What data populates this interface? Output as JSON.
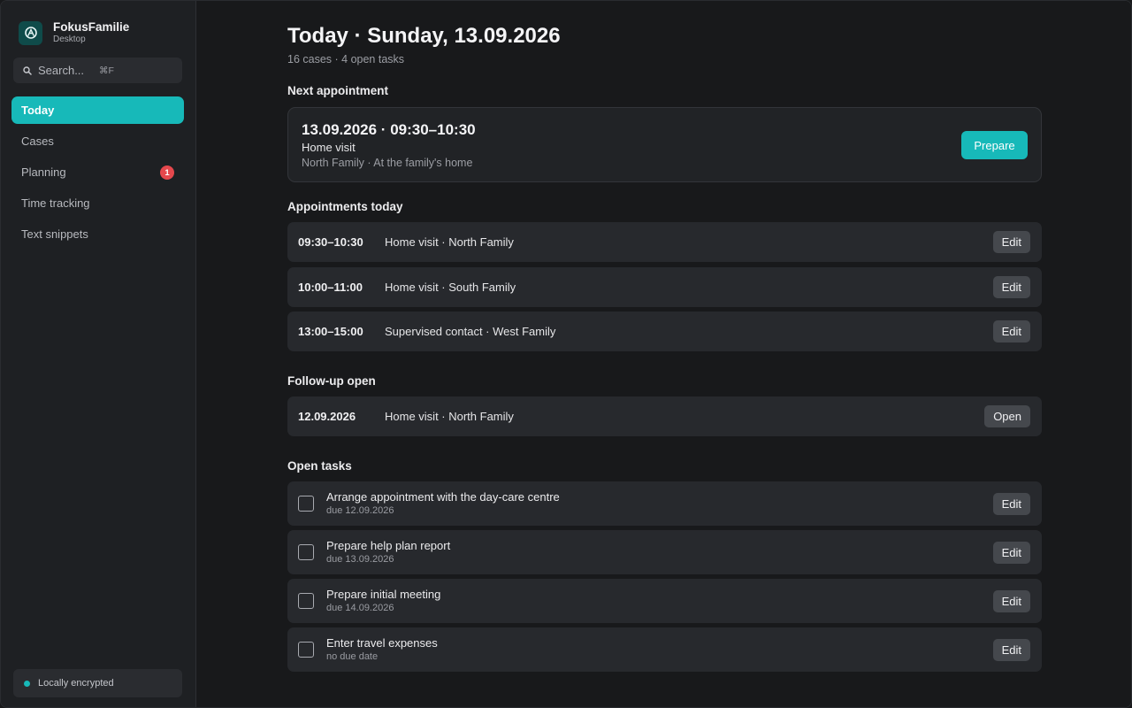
{
  "app": {
    "name": "FokusFamilie",
    "subtitle": "Desktop"
  },
  "search": {
    "placeholder": "Search...",
    "shortcut": "⌘F"
  },
  "nav": [
    {
      "label": "Today",
      "active": true
    },
    {
      "label": "Cases"
    },
    {
      "label": "Planning",
      "badge": "1"
    },
    {
      "label": "Time tracking"
    },
    {
      "label": "Text snippets"
    }
  ],
  "status": {
    "label": "Locally encrypted",
    "color": "#17b9b9"
  },
  "header": {
    "title": "Today · Sunday, 13.09.2026",
    "summary": "16 cases · 4 open tasks"
  },
  "next_appointment": {
    "heading": "Next appointment",
    "when": "13.09.2026 · 09:30–10:30",
    "type": "Home visit",
    "where": "North Family · At the family's home",
    "action": "Prepare"
  },
  "appointments": {
    "heading": "Appointments today",
    "items": [
      {
        "time": "09:30–10:30",
        "desc": "Home visit · North Family",
        "action": "Edit"
      },
      {
        "time": "10:00–11:00",
        "desc": "Home visit · South Family",
        "action": "Edit"
      },
      {
        "time": "13:00–15:00",
        "desc": "Supervised contact · West Family",
        "action": "Edit"
      }
    ]
  },
  "followup": {
    "heading": "Follow-up open",
    "items": [
      {
        "date": "12.09.2026",
        "desc": "Home visit · North Family",
        "action": "Open"
      }
    ]
  },
  "tasks": {
    "heading": "Open tasks",
    "items": [
      {
        "title": "Arrange appointment with the day-care centre",
        "due": "due 12.09.2026",
        "action": "Edit"
      },
      {
        "title": "Prepare help plan report",
        "due": "due 13.09.2026",
        "action": "Edit"
      },
      {
        "title": "Prepare initial meeting",
        "due": "due 14.09.2026",
        "action": "Edit"
      },
      {
        "title": "Enter travel expenses",
        "due": "no due date",
        "action": "Edit"
      }
    ]
  },
  "colors": {
    "accent": "#17b9b9",
    "badge": "#e5484d",
    "background": "#18191b",
    "sidebar": "#1e2023"
  }
}
